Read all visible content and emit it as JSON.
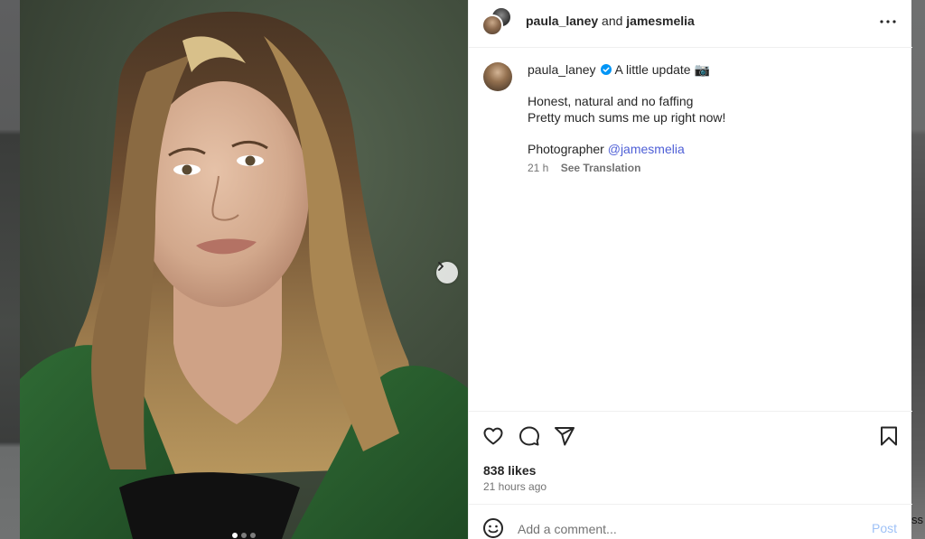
{
  "header": {
    "author1": "paula_laney",
    "conjunction": "and",
    "author2": "jamesmelia"
  },
  "caption": {
    "username": "paula_laney",
    "headline": "A little update 📷",
    "lines": [
      "Honest, natural and no faffing",
      "Pretty much sums me up right now!"
    ],
    "photographer_prefix": "Photographer ",
    "mention": "@jamesmelia",
    "time": "21 h",
    "see_translation": "See Translation"
  },
  "engagement": {
    "likes": "838 likes",
    "posted": "21 hours ago"
  },
  "comment": {
    "placeholder": "Add a comment...",
    "post_label": "Post"
  },
  "carousel": {
    "slides": 3,
    "active": 1
  },
  "edge_text": "ss",
  "colors": {
    "link": "#4e5fd6",
    "verified": "#0095f6",
    "post_disabled": "#9fc2f7",
    "muted": "#737373",
    "jacket_green": "#2c5a2c"
  },
  "icons": [
    "more-icon",
    "verified-icon",
    "heart-icon",
    "comment-icon",
    "share-icon",
    "bookmark-icon",
    "emoji-icon",
    "chevron-right-icon"
  ]
}
